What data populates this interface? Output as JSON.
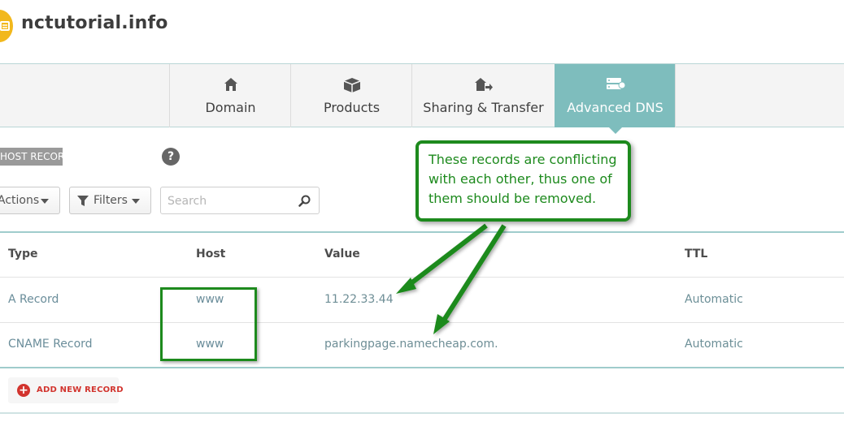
{
  "header": {
    "domain_name": "nctutorial.info",
    "logo_icon": "tag-icon"
  },
  "tabs": [
    {
      "label": "Domain",
      "icon": "home-icon",
      "active": false
    },
    {
      "label": "Products",
      "icon": "box-icon",
      "active": false
    },
    {
      "label": "Sharing & Transfer",
      "icon": "transfer-icon",
      "active": false
    },
    {
      "label": "Advanced DNS",
      "icon": "server-icon",
      "active": true
    }
  ],
  "toolbar": {
    "section_label": "HOST RECORDS",
    "help_label": "?",
    "actions_label": "Actions",
    "filters_label": "Filters",
    "search_placeholder": "Search"
  },
  "table": {
    "columns": [
      "Type",
      "Host",
      "Value",
      "TTL"
    ],
    "rows": [
      {
        "type": "A Record",
        "host": "www",
        "value": "11.22.33.44",
        "ttl": "Automatic"
      },
      {
        "type": "CNAME Record",
        "host": "www",
        "value": "parkingpage.namecheap.com.",
        "ttl": "Automatic"
      }
    ],
    "add_label": "ADD NEW RECORD"
  },
  "annotation": {
    "line1": "These records are conflicting",
    "line2": "with each other, thus one of",
    "line3": "them should be removed.",
    "color": "#1d8a1d"
  },
  "colors": {
    "active_tab": "#7ebdbd",
    "accent_red": "#d2342e",
    "logo_yellow": "#f2b81c"
  }
}
